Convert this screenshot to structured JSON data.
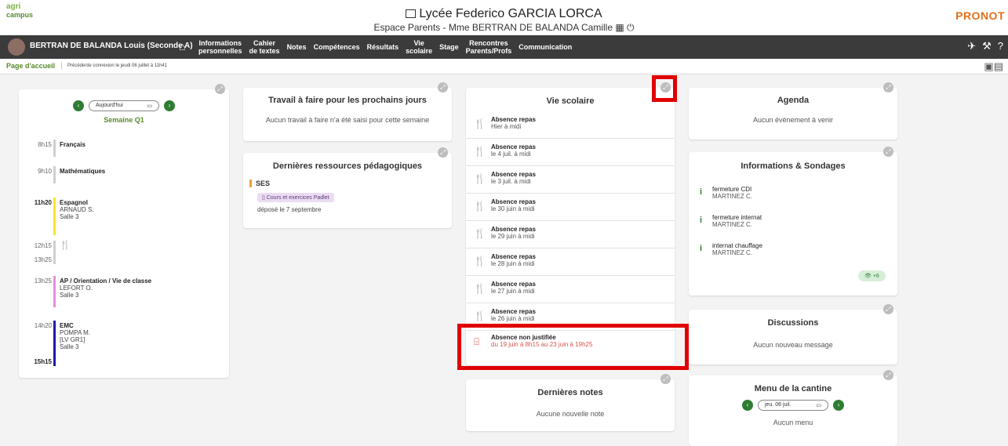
{
  "header": {
    "logo_line1": "agri",
    "logo_line2": "campus",
    "school": "Lycée Federico GARCIA LORCA",
    "space": "Espace Parents - Mme BERTRAN DE BALANDA Camille",
    "brand": "PRONOT"
  },
  "nav": {
    "student": "BERTRAN DE BALANDA Louis (Seconde A)",
    "items": [
      {
        "l1": "Informations",
        "l2": "personnelles"
      },
      {
        "l1": "Cahier",
        "l2": "de textes"
      },
      {
        "l1": "Notes",
        "l2": ""
      },
      {
        "l1": "Compétences",
        "l2": ""
      },
      {
        "l1": "Résultats",
        "l2": ""
      },
      {
        "l1": "Vie",
        "l2": "scolaire"
      },
      {
        "l1": "Stage",
        "l2": ""
      },
      {
        "l1": "Rencontres",
        "l2": "Parents/Profs"
      },
      {
        "l1": "Communication",
        "l2": ""
      }
    ]
  },
  "subbar": {
    "home": "Page d'accueil",
    "last": "Précédente connexion le jeudi 06 juillet à 11h41"
  },
  "edt": {
    "date": "Aujourd'hui",
    "week": "Semaine Q1",
    "slots": [
      {
        "time": "8h15",
        "subject": "Français",
        "detail": [
          "",
          ""
        ],
        "color": "#cfcfcf"
      },
      {
        "time": "9h10",
        "subject": "Mathématiques",
        "detail": [
          "",
          ""
        ],
        "color": "#cfcfcf"
      },
      {
        "time": "11h20",
        "subject": "Espagnol",
        "detail": [
          "ARNAUD S.",
          "Salle 3"
        ],
        "color": "#f4e82a"
      },
      {
        "time": "12h15",
        "time2": "13h25",
        "subject": "",
        "detail": [
          "",
          ""
        ],
        "color": "#cfcfcf"
      },
      {
        "time": "13h25",
        "subject": "AP / Orientation / Vie de classe",
        "detail": [
          "LEFORT O.",
          "Salle 3"
        ],
        "color": "#e88be0"
      },
      {
        "time": "14h20",
        "time2": "15h15",
        "subject": "EMC",
        "detail": [
          "POMPA M.",
          "[LV GR1]",
          "Salle 3"
        ],
        "color": "#1a1aa8"
      }
    ]
  },
  "travail": {
    "title": "Travail à faire pour les prochains jours",
    "empty": "Aucun travail à faire n'a été saisi pour cette semaine"
  },
  "ressources": {
    "title": "Dernières ressources pédagogiques",
    "subject": "SES",
    "chip": "Cours et exercices Padlet",
    "date": "déposé le 7 septembre"
  },
  "vie": {
    "title": "Vie scolaire",
    "items": [
      {
        "t": "Absence repas",
        "d": "Hier à midi"
      },
      {
        "t": "Absence repas",
        "d": "le 4 juil. à midi"
      },
      {
        "t": "Absence repas",
        "d": "le 3 juil. à midi"
      },
      {
        "t": "Absence repas",
        "d": "le 30 juin à midi"
      },
      {
        "t": "Absence repas",
        "d": "le 29 juin à midi"
      },
      {
        "t": "Absence repas",
        "d": "le 28 juin à midi"
      },
      {
        "t": "Absence repas",
        "d": "le 27 juin à midi"
      },
      {
        "t": "Absence repas",
        "d": "le 26 juin à midi"
      }
    ],
    "absence": {
      "t": "Absence non justifiée",
      "d": "du 19 juin à 8h15 au 23 juin à 19h25"
    }
  },
  "notes": {
    "title": "Dernières notes",
    "empty": "Aucune nouvelle note"
  },
  "agenda": {
    "title": "Agenda",
    "empty": "Aucun évènement à venir"
  },
  "infos": {
    "title": "Informations & Sondages",
    "items": [
      {
        "t": "fermeture CDI",
        "a": "MARTINEZ C."
      },
      {
        "t": "fermeture internat",
        "a": "MARTINEZ C."
      },
      {
        "t": "internat chauffage",
        "a": "MARTINEZ C."
      }
    ],
    "more": "+6"
  },
  "discussions": {
    "title": "Discussions",
    "empty": "Aucun nouveau message"
  },
  "cantine": {
    "title": "Menu de la cantine",
    "date": "jeu. 06 juil.",
    "empty": "Aucun menu"
  }
}
